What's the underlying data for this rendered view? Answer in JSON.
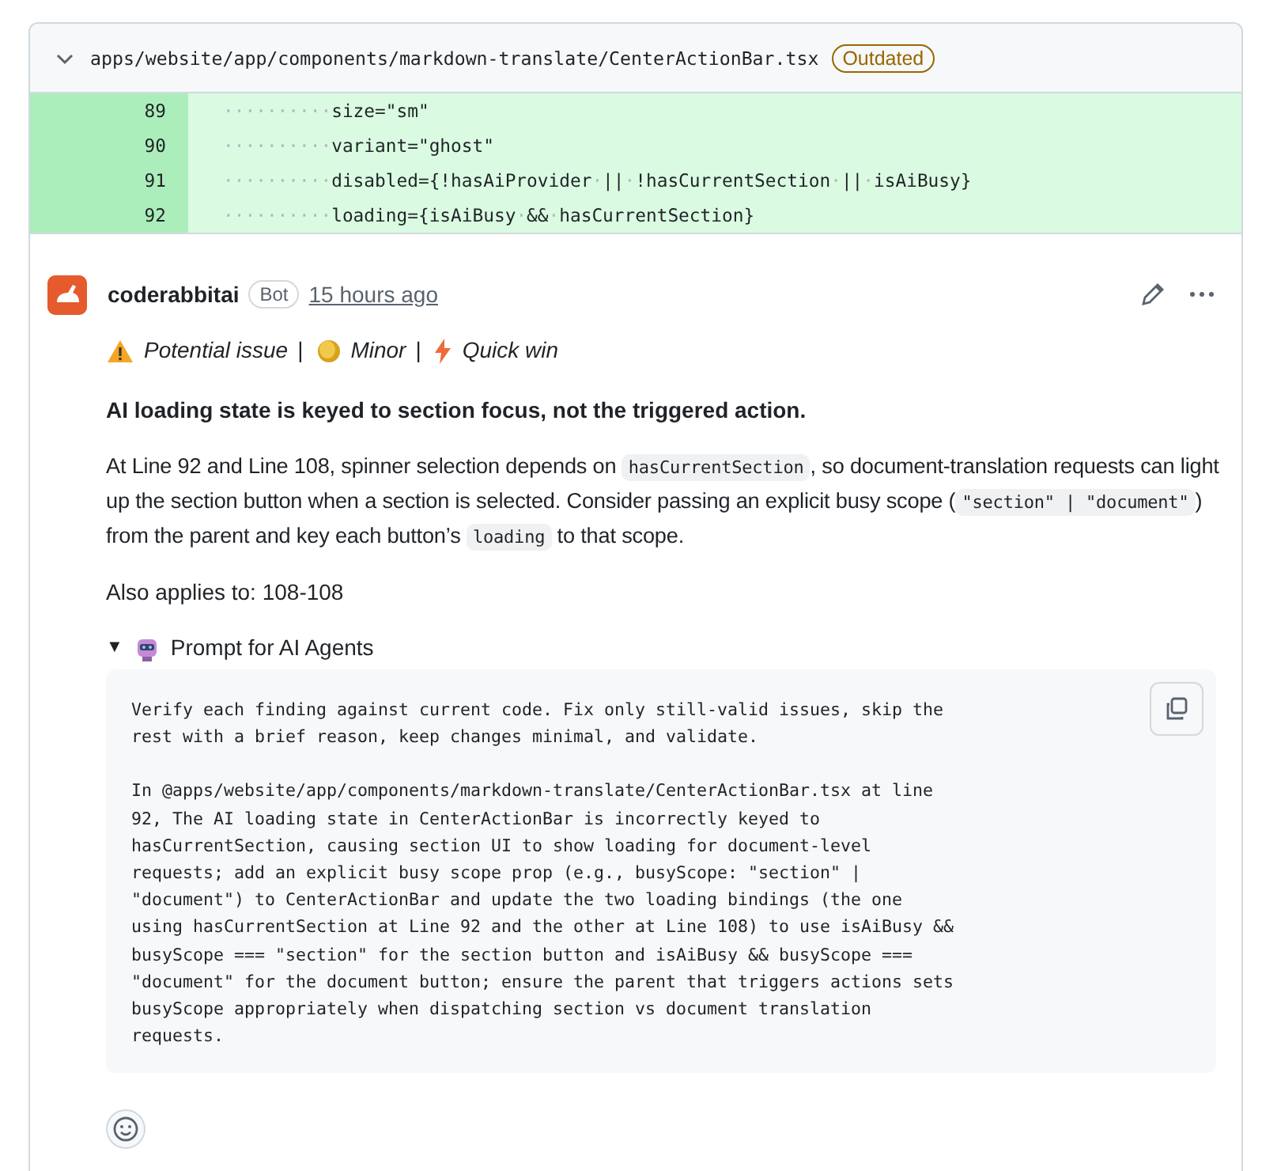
{
  "file_header": {
    "path": "apps/website/app/components/markdown-translate/CenterActionBar.tsx",
    "badge": "Outdated",
    "expanded": true
  },
  "code_lines": [
    {
      "number": "89",
      "text": "··········size=\"sm\""
    },
    {
      "number": "90",
      "text": "··········variant=\"ghost\""
    },
    {
      "number": "91",
      "text": "··········disabled={!hasAiProvider·||·!hasCurrentSection·||·isAiBusy}"
    },
    {
      "number": "92",
      "text": "··········loading={isAiBusy·&&·hasCurrentSection}"
    }
  ],
  "comment": {
    "author": "coderabbitai",
    "author_badge": "Bot",
    "time": "15 hours ago",
    "tags": [
      {
        "kind": "warning",
        "label": "Potential issue",
        "separator": "|"
      },
      {
        "kind": "coin",
        "label": "Minor",
        "separator": "|"
      },
      {
        "kind": "bolt",
        "label": "Quick win"
      }
    ],
    "title": "AI loading state is keyed to section focus, not the triggered action.",
    "paragraph": [
      {
        "kind": "text",
        "text": "At Line 92 and Line 108, spinner selection depends on "
      },
      {
        "kind": "code",
        "text": "hasCurrentSection"
      },
      {
        "kind": "text",
        "text": ", so document-translation requests can light up the section button when a section is selected. Consider passing an explicit busy scope ("
      },
      {
        "kind": "code",
        "text": "\"section\" | \"document\""
      },
      {
        "kind": "text",
        "text": ") from the parent and key each button’s "
      },
      {
        "kind": "code",
        "text": "loading"
      },
      {
        "kind": "text",
        "text": " to that scope."
      }
    ],
    "also_applies": "Also applies to: 108-108",
    "prompt": {
      "toggle": "▼",
      "summary": "Prompt for AI Agents",
      "expanded": true,
      "paragraphs": [
        "Verify each finding against current code. Fix only still-valid issues, skip the\nrest with a brief reason, keep changes minimal, and validate.",
        "In @apps/website/app/components/markdown-translate/CenterActionBar.tsx at line\n92, The AI loading state in CenterActionBar is incorrectly keyed to\nhasCurrentSection, causing section UI to show loading for document-level\nrequests; add an explicit busy scope prop (e.g., busyScope: \"section\" |\n\"document\") to CenterActionBar and update the two loading bindings (the one\nusing hasCurrentSection at Line 92 and the other at Line 108) to use isAiBusy &&\nbusyScope === \"section\" for the section button and isAiBusy && busyScope ===\n\"document\" for the document button; ensure the parent that triggers actions sets\nbusyScope appropriately when dispatching section vs document translation\nrequests."
      ]
    }
  }
}
